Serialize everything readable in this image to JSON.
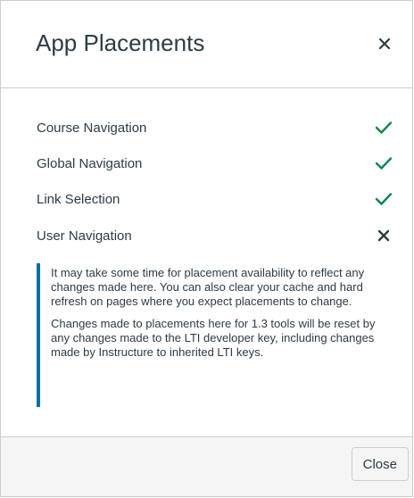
{
  "modal": {
    "title": "App Placements",
    "close_icon": "close-icon"
  },
  "placements": [
    {
      "label": "Course Navigation",
      "enabled": true,
      "icon": "check-icon",
      "color": "#0b874b"
    },
    {
      "label": "Global Navigation",
      "enabled": true,
      "icon": "check-icon",
      "color": "#0b874b"
    },
    {
      "label": "Link Selection",
      "enabled": true,
      "icon": "check-icon",
      "color": "#0b874b"
    },
    {
      "label": "User Navigation",
      "enabled": false,
      "icon": "x-icon",
      "color": "#2d3b45"
    }
  ],
  "alert": {
    "paragraph_1": "It may take some time for placement availability to reflect any changes made here. You can also clear your cache and hard refresh on pages where you expect placements to change.",
    "paragraph_2": "Changes made to placements here for 1.3 tools will be reset by any changes made to the LTI developer key, including changes made by Instructure to inherited LTI keys.",
    "accent_color": "#0770a3"
  },
  "footer": {
    "close_label": "Close"
  }
}
